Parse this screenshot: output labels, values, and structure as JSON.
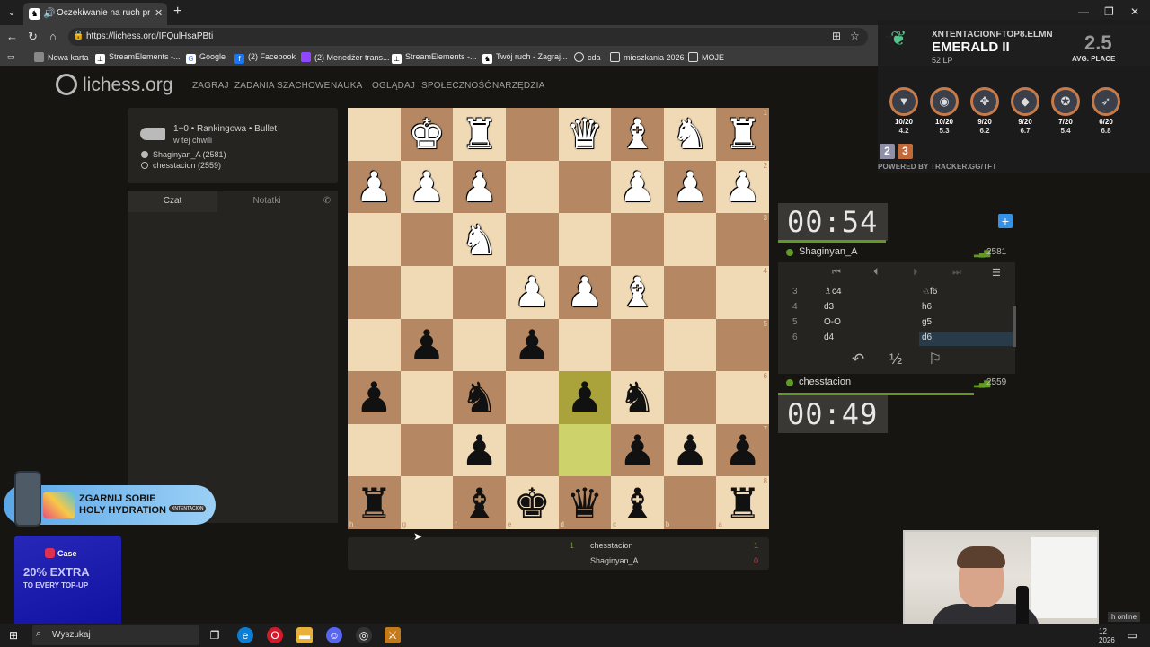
{
  "browser": {
    "tab_title": "Oczekiwanie na ruch przeciwnika",
    "url": "https://lichess.org/IFQulHsaPBti",
    "bookmarks": [
      "Nowa karta",
      "StreamElements -...",
      "Google",
      "(2) Facebook",
      "(2) Menedżer trans...",
      "StreamElements -...",
      "Twój ruch - Zagraj...",
      "cda",
      "mieszkania 2026",
      "MOJE"
    ]
  },
  "site": {
    "logo": "lichess.org",
    "menu": [
      "ZAGRAJ",
      "ZADANIA SZACHOWE",
      "NAUKA",
      "OGLĄDAJ",
      "SPOŁECZNOŚĆ",
      "NARZĘDZIA"
    ]
  },
  "game": {
    "mode": "1+0 • Rankingowa • Bullet",
    "when": "w tej chwili",
    "white": "Shaginyan_A (2581)",
    "black": "chesstacion (2559)",
    "tabs": [
      "Czat",
      "Notatki"
    ]
  },
  "board": {
    "rows": [
      [
        "",
        "wK",
        "wR",
        "",
        "wQ",
        "wB",
        "wN",
        "wR"
      ],
      [
        "wP",
        "wP",
        "wP",
        "",
        "",
        "wP",
        "wP",
        "wP"
      ],
      [
        "",
        "",
        "wN",
        "",
        "",
        "",
        "",
        ""
      ],
      [
        "",
        "",
        "",
        "wP",
        "wP",
        "wB",
        "",
        ""
      ],
      [
        "",
        "bP",
        "",
        "bP",
        "",
        "",
        "",
        ""
      ],
      [
        "bP",
        "",
        "bN",
        "",
        "bP",
        "bN",
        "",
        ""
      ],
      [
        "",
        "",
        "bP",
        "",
        "",
        "bP",
        "bP",
        "bP"
      ],
      [
        "bR",
        "",
        "bB",
        "bK",
        "bQ",
        "bB",
        "",
        "bR"
      ]
    ],
    "highlight": [
      "5-4",
      "6-4"
    ],
    "ranks": [
      "1",
      "2",
      "3",
      "4",
      "5",
      "6",
      "7",
      "8"
    ],
    "files": [
      "h",
      "g",
      "f",
      "e",
      "d",
      "c",
      "b",
      "a"
    ]
  },
  "result": {
    "left_score": "1",
    "rows": [
      {
        "name": "chesstacion",
        "score": "1"
      },
      {
        "name": "Shaginyan_A",
        "score": "0"
      }
    ]
  },
  "clocks": {
    "top": {
      "time": "00:54",
      "name": "Shaginyan_A",
      "rating": "2581"
    },
    "bottom": {
      "time": "00:49",
      "name": "chesstacion",
      "rating": "2559"
    }
  },
  "moves": [
    {
      "n": "3",
      "w": "♗c4",
      "b": "♘f6"
    },
    {
      "n": "4",
      "w": "d3",
      "b": "h6"
    },
    {
      "n": "5",
      "w": "O-O",
      "b": "g5"
    },
    {
      "n": "6",
      "w": "d4",
      "b": "d6"
    }
  ],
  "tft": {
    "nick": "XNTENTACIONFTOP8.ELMN",
    "rank": "EMERALD II",
    "lp": "52 LP",
    "avg": "2.5",
    "avg_label": "AVG. PLACE",
    "champs": [
      {
        "score": "10/20",
        "avg": "4.2"
      },
      {
        "score": "10/20",
        "avg": "5.3"
      },
      {
        "score": "9/20",
        "avg": "6.2"
      },
      {
        "score": "9/20",
        "avg": "6.7"
      },
      {
        "score": "7/20",
        "avg": "5.4"
      },
      {
        "score": "6/20",
        "avg": "6.8"
      }
    ],
    "stages": [
      "2",
      "3"
    ],
    "powered": "POWERED BY TRACKER.GG/TFT"
  },
  "promo1": {
    "line1": "ZGARNIJ SOBIE",
    "line2": "HOLY HYDRATION",
    "tag": "XNTENTACION"
  },
  "promo2": {
    "brand": "Case",
    "big": "20% EXTRA",
    "small": "TO EVERY TOP-UP"
  },
  "taskbar": {
    "search": "Wyszukaj",
    "tray_online": "h online",
    "tray_time": "12",
    "tray_date": "2026"
  }
}
